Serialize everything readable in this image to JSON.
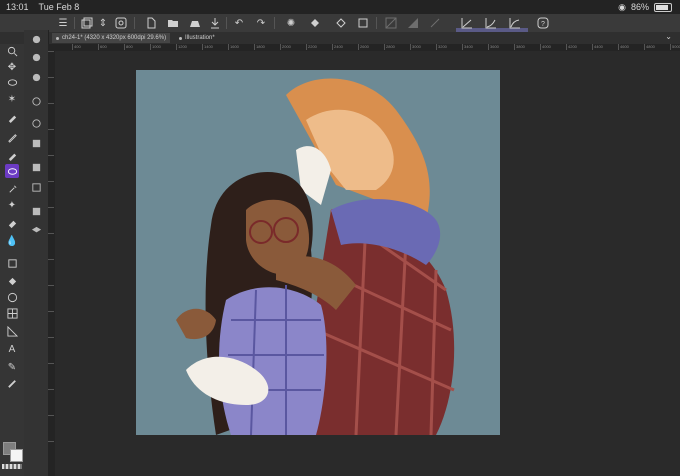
{
  "status": {
    "time": "13:01",
    "date": "Tue Feb 8",
    "battery": "86%",
    "battery_level": 0.86
  },
  "tabs": [
    {
      "label": "ch24-1* (4320 x 4320px 600dpi 29.6%)"
    },
    {
      "label": "Illustration*"
    }
  ],
  "ruler": {
    "top_ticks": [
      "400",
      "600",
      "800",
      "1000",
      "1200",
      "1400",
      "1600",
      "1800",
      "2000",
      "2200",
      "2400",
      "2600",
      "2800",
      "3000",
      "3200",
      "3400",
      "3600",
      "3800",
      "4000",
      "4200",
      "4400",
      "4600",
      "4800",
      "5000"
    ]
  },
  "toolbar_icons": [
    "menu-icon",
    "layers-icon",
    "chevron-updown-icon",
    "fullscreen-icon",
    "new-file-icon",
    "open-folder-icon",
    "save-icon",
    "export-icon",
    "undo-icon",
    "redo-icon",
    "settings-icon",
    "fill-icon",
    "transform-icon",
    "pattern-icon",
    "smoothing-icon",
    "pen-pressure-1-icon",
    "pen-pressure-2-icon",
    "pen-pressure-3-icon",
    "help-icon"
  ],
  "tools": [
    "zoom-icon",
    "move-icon",
    "lasso-icon",
    "magic-wand-icon",
    "eyedropper-icon",
    "pen-icon",
    "pencil-icon",
    "brush-icon",
    "airbrush-icon",
    "decoration-icon",
    "eraser-icon",
    "blend-icon",
    "fill-icon",
    "gradient-icon",
    "figure-icon",
    "frame-icon",
    "ruler-icon",
    "text-icon",
    "balloon-icon",
    "correction-icon"
  ],
  "colors": {
    "accent": "#6c3bc4",
    "highlight": "#5a5a86",
    "main_color": "#7e7e7e",
    "sub_color": "#f4f4f4",
    "canvas_bg": "#6d8a95"
  }
}
